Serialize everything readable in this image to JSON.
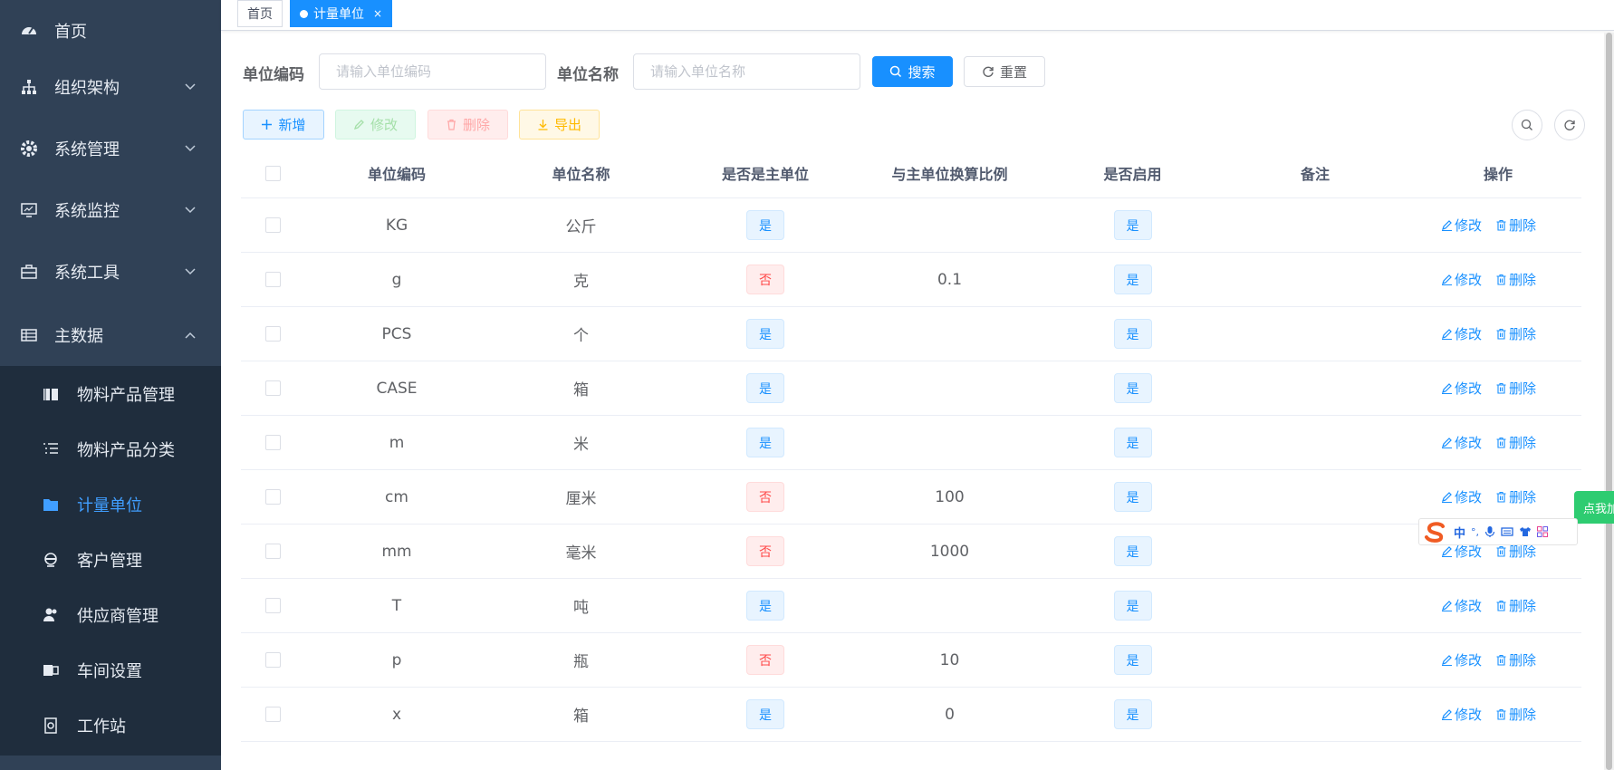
{
  "sidebar": {
    "items": [
      {
        "label": "首页",
        "icon": "dashboard-icon"
      },
      {
        "label": "组织架构",
        "icon": "org-tree-icon"
      },
      {
        "label": "系统管理",
        "icon": "gear-icon"
      },
      {
        "label": "系统监控",
        "icon": "monitor-icon"
      },
      {
        "label": "系统工具",
        "icon": "toolbox-icon"
      },
      {
        "label": "主数据",
        "icon": "table-icon"
      }
    ],
    "subitems": [
      {
        "label": "物料产品管理",
        "icon": "book-icon"
      },
      {
        "label": "物料产品分类",
        "icon": "list-tree-icon"
      },
      {
        "label": "计量单位",
        "icon": "folder-icon"
      },
      {
        "label": "客户管理",
        "icon": "customer-icon"
      },
      {
        "label": "供应商管理",
        "icon": "peoples-icon"
      },
      {
        "label": "车间设置",
        "icon": "workshop-icon"
      },
      {
        "label": "工作站",
        "icon": "station-icon"
      }
    ]
  },
  "tags": {
    "home": "首页",
    "active": "计量单位",
    "close": "×"
  },
  "search": {
    "code_label": "单位编码",
    "code_placeholder": "请输入单位编码",
    "name_label": "单位名称",
    "name_placeholder": "请输入单位名称",
    "search_btn": "搜索",
    "reset_btn": "重置"
  },
  "toolbar": {
    "add": "新增",
    "edit": "修改",
    "delete": "删除",
    "export": "导出"
  },
  "table": {
    "headers": [
      "单位编码",
      "单位名称",
      "是否是主单位",
      "与主单位换算比例",
      "是否启用",
      "备注",
      "操作"
    ],
    "rows": [
      {
        "code": "KG",
        "name": "公斤",
        "primary": "是",
        "ratio": "",
        "enabled": "是",
        "remark": ""
      },
      {
        "code": "g",
        "name": "克",
        "primary": "否",
        "ratio": "0.1",
        "enabled": "是",
        "remark": ""
      },
      {
        "code": "PCS",
        "name": "个",
        "primary": "是",
        "ratio": "",
        "enabled": "是",
        "remark": ""
      },
      {
        "code": "CASE",
        "name": "箱",
        "primary": "是",
        "ratio": "",
        "enabled": "是",
        "remark": ""
      },
      {
        "code": "m",
        "name": "米",
        "primary": "是",
        "ratio": "",
        "enabled": "是",
        "remark": ""
      },
      {
        "code": "cm",
        "name": "厘米",
        "primary": "否",
        "ratio": "100",
        "enabled": "是",
        "remark": ""
      },
      {
        "code": "mm",
        "name": "毫米",
        "primary": "否",
        "ratio": "1000",
        "enabled": "是",
        "remark": ""
      },
      {
        "code": "T",
        "name": "吨",
        "primary": "是",
        "ratio": "",
        "enabled": "是",
        "remark": ""
      },
      {
        "code": "p",
        "name": "瓶",
        "primary": "否",
        "ratio": "10",
        "enabled": "是",
        "remark": ""
      },
      {
        "code": "x",
        "name": "箱",
        "primary": "是",
        "ratio": "0",
        "enabled": "是",
        "remark": ""
      }
    ],
    "op_edit": "修改",
    "op_delete": "删除"
  },
  "overlay": {
    "ime_label": "中",
    "green_tab": "点我加"
  },
  "colors": {
    "sidebar": "#304156",
    "submenu": "#1f2d3d",
    "primary": "#1890ff",
    "danger": "#ff4949"
  }
}
